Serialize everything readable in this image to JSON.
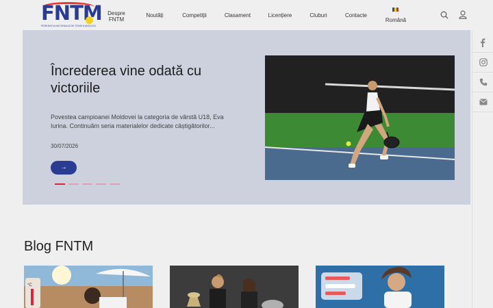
{
  "header": {
    "logo": {
      "text": "FNTM",
      "subtitle": "FEDERAȚIA NAȚIONALĂ DE TENIS A MOLDOVEI"
    },
    "nav": [
      {
        "label": "Despre FNTM"
      },
      {
        "label": "Noutăți"
      },
      {
        "label": "Competiții"
      },
      {
        "label": "Clasament"
      },
      {
        "label": "Licențiere"
      },
      {
        "label": "Cluburi"
      },
      {
        "label": "Contacte"
      },
      {
        "label": "Română"
      }
    ],
    "icons": [
      "search-icon",
      "user-icon"
    ]
  },
  "hero": {
    "title": "Încrederea vine odată cu victoriile",
    "excerpt": "Povestea campioanei Moldovei la categoria de vârstă U18, Eva Iurina. Continuăm seria materialelor dedicate câștigătorilor...",
    "date": "30/07/2026",
    "button_icon": "→",
    "slides": 5,
    "active_slide": 1
  },
  "social": [
    "facebook-icon",
    "instagram-icon",
    "phone-icon",
    "email-icon"
  ],
  "blog": {
    "title": "Blog FNTM"
  },
  "colors": {
    "brand": "#2a3c91",
    "accent": "#d6263d",
    "hero_bg": "#ccd1dd",
    "page_bg": "#efefef"
  }
}
